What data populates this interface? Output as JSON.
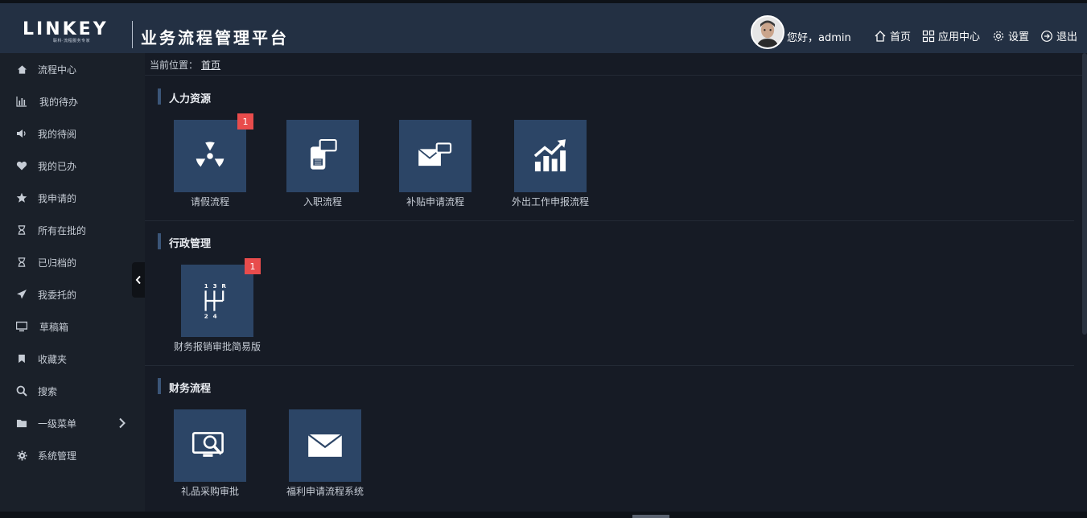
{
  "header": {
    "logo_text": "LINKEY",
    "logo_sub": "联科·流程服务专家",
    "app_title": "业务流程管理平台",
    "greeting": "您好，admin",
    "nav": [
      {
        "label": "首页",
        "icon": "home-icon"
      },
      {
        "label": "应用中心",
        "icon": "grid-icon"
      },
      {
        "label": "设置",
        "icon": "gear-icon"
      },
      {
        "label": "退出",
        "icon": "logout-icon"
      }
    ]
  },
  "sidebar": {
    "items": [
      {
        "label": "流程中心",
        "icon": "home-icon"
      },
      {
        "label": "我的待办",
        "icon": "bar-chart-icon"
      },
      {
        "label": "我的待阅",
        "icon": "volume-icon"
      },
      {
        "label": "我的已办",
        "icon": "heart-icon"
      },
      {
        "label": "我申请的",
        "icon": "star-icon"
      },
      {
        "label": "所有在批的",
        "icon": "hourglass-icon"
      },
      {
        "label": "已归档的",
        "icon": "hourglass-icon"
      },
      {
        "label": "我委托的",
        "icon": "send-icon"
      },
      {
        "label": "草稿箱",
        "icon": "monitor-icon"
      },
      {
        "label": "收藏夹",
        "icon": "bookmark-icon"
      },
      {
        "label": "搜索",
        "icon": "search-icon"
      },
      {
        "label": "一级菜单",
        "icon": "folder-icon"
      },
      {
        "label": "系统管理",
        "icon": "gear-icon"
      }
    ]
  },
  "breadcrumb": {
    "prefix": "当前位置：",
    "current": "首页"
  },
  "sections": [
    {
      "title": "人力资源",
      "tiles": [
        {
          "label": "请假流程",
          "icon": "radiation-icon",
          "badge": "1"
        },
        {
          "label": "入职流程",
          "icon": "phone-chat-icon",
          "badge": ""
        },
        {
          "label": "补贴申请流程",
          "icon": "mail-chat-icon",
          "badge": ""
        },
        {
          "label": "外出工作申报流程",
          "icon": "growth-chart-icon",
          "badge": ""
        }
      ]
    },
    {
      "title": "行政管理",
      "tiles": [
        {
          "label": "财务报销审批简易版",
          "icon": "gear-shift-icon",
          "badge": "1"
        }
      ]
    },
    {
      "title": "财务流程",
      "tiles": [
        {
          "label": "礼品采购审批",
          "icon": "monitor-search-icon",
          "badge": ""
        },
        {
          "label": "福利申请流程系统",
          "icon": "envelope-icon",
          "badge": ""
        }
      ]
    }
  ],
  "colors": {
    "topbar": "#233043",
    "sidebar": "#1a2029",
    "main": "#161b25",
    "tile": "#2c4566",
    "badge": "#e84c4c"
  }
}
